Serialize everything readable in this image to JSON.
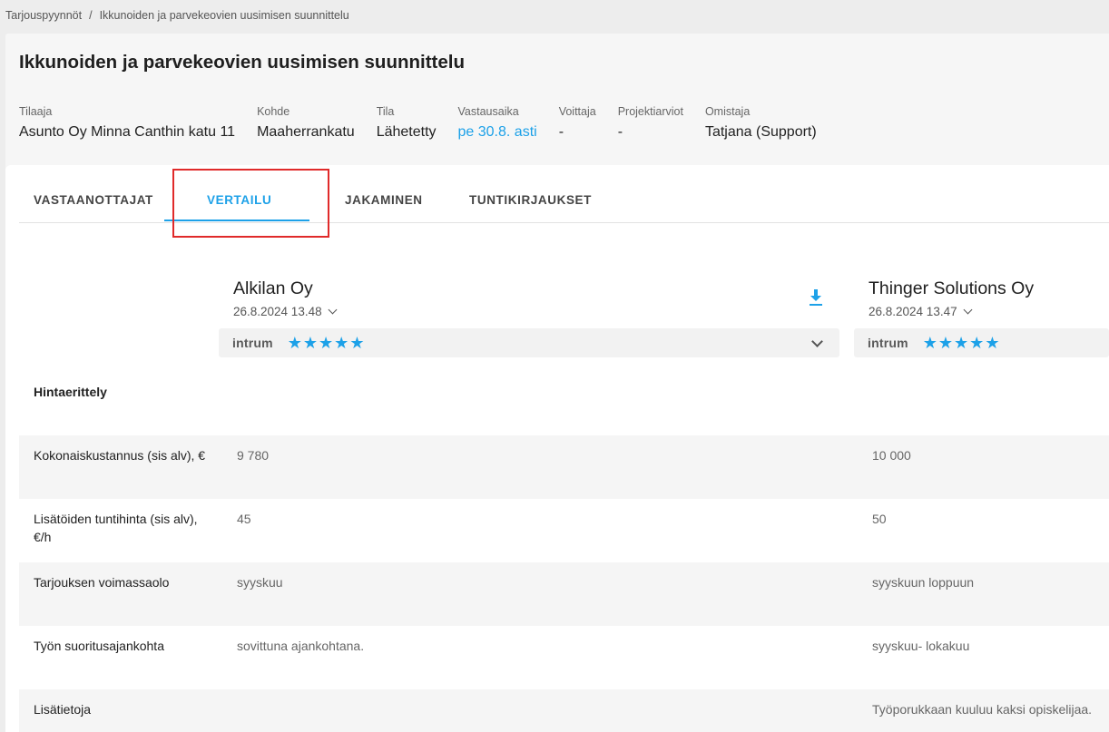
{
  "breadcrumb": {
    "root": "Tarjouspyynnöt",
    "separator": "/",
    "current": "Ikkunoiden ja parvekeovien uusimisen suunnittelu"
  },
  "header": {
    "title": "Ikkunoiden ja parvekeovien uusimisen suunnittelu",
    "meta": [
      {
        "label": "Tilaaja",
        "value": "Asunto Oy Minna Canthin katu 11"
      },
      {
        "label": "Kohde",
        "value": "Maaherrankatu"
      },
      {
        "label": "Tila",
        "value": "Lähetetty"
      },
      {
        "label": "Vastausaika",
        "value": "pe 30.8. asti"
      },
      {
        "label": "Voittaja",
        "value": "-"
      },
      {
        "label": "Projektiarviot",
        "value": "-"
      },
      {
        "label": "Omistaja",
        "value": "Tatjana (Support)"
      }
    ]
  },
  "tabs": [
    {
      "label": "VASTAANOTTAJAT"
    },
    {
      "label": "VERTAILU",
      "active": true
    },
    {
      "label": "JAKAMINEN"
    },
    {
      "label": "TUNTIKIRJAUKSET"
    }
  ],
  "vendors": [
    {
      "name": "Alkilan Oy",
      "date": "26.8.2024 13.48",
      "rating_provider": "intrum",
      "stars": 5,
      "stars_display": "★★★★★"
    },
    {
      "name": "Thinger Solutions Oy",
      "date": "26.8.2024 13.47",
      "rating_provider": "intrum",
      "stars": 5,
      "stars_display": "★★★★★"
    }
  ],
  "section": {
    "label": "Hintaerittely"
  },
  "rows": [
    {
      "label": "Kokonaiskustannus (sis alv), €",
      "values": [
        "9 780",
        "10 000"
      ]
    },
    {
      "label": "Lisätöiden tuntihinta (sis alv), €/h",
      "values": [
        "45",
        "50"
      ]
    },
    {
      "label": "Tarjouksen voimassaolo",
      "values": [
        "syyskuu",
        "syyskuun loppuun"
      ]
    },
    {
      "label": "Työn suoritusajankohta",
      "values": [
        "sovittuna ajankohtana.",
        "syyskuu- lokakuu"
      ]
    },
    {
      "label": "Lisätietoja",
      "values": [
        "",
        "Työporukkaan kuuluu kaksi opiskelijaa."
      ]
    }
  ],
  "colors": {
    "accent": "#1da1e8",
    "highlight": "#e02a2a"
  }
}
